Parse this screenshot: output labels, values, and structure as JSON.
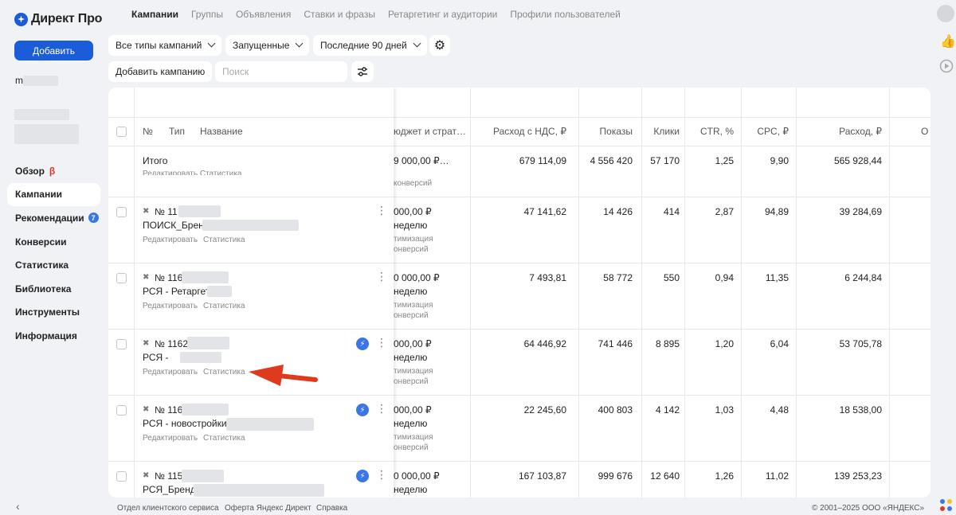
{
  "sidebar": {
    "logo_text": "Директ Про",
    "add_button": "Добавить",
    "account_letter": "m",
    "nav": [
      {
        "label": "Обзор",
        "badge": "β"
      },
      {
        "label": "Кампании",
        "active": true
      },
      {
        "label": "Рекомендации",
        "count": "7"
      },
      {
        "label": "Конверсии"
      },
      {
        "label": "Статистика"
      },
      {
        "label": "Библиотека"
      },
      {
        "label": "Инструменты"
      },
      {
        "label": "Информация"
      }
    ]
  },
  "tabs": [
    "Кампании",
    "Группы",
    "Объявления",
    "Ставки и фразы",
    "Ретаргетинг и аудитории",
    "Профили пользователей"
  ],
  "filters": {
    "type": "Все типы кампаний",
    "status": "Запущенные",
    "period": "Последние 90 дней",
    "add_campaign": "Добавить кампанию",
    "search_placeholder": "Поиск"
  },
  "table": {
    "headers": {
      "num": "№",
      "type": "Тип",
      "name": "Название",
      "budget": "юджет и страт…",
      "cost_vat": "Расход с НДС, ₽",
      "impressions": "Показы",
      "clicks": "Клики",
      "ctr": "CTR, %",
      "cpc": "CPC, ₽",
      "cost": "Расход, ₽",
      "extra": "О"
    },
    "total": {
      "label": "Итого",
      "budget": "9 000,00 ₽…",
      "cost_vat": "679 114,09",
      "impressions": "4 556 420",
      "clicks": "57 170",
      "ctr": "1,25",
      "cpc": "9,90",
      "cost": "565 928,44",
      "under_links": "Редактировать  Статистика",
      "under_budget": "конверсий"
    },
    "rows": [
      {
        "num": "№ 11",
        "name": "ПОИСК_Брен",
        "budget": "000,00 ₽",
        "budget2": "неделю",
        "strategy1": "тимизация",
        "strategy2": "онверсий",
        "cost_vat": "47 141,62",
        "impressions": "14 426",
        "clicks": "414",
        "ctr": "2,87",
        "cpc": "94,89",
        "cost": "39 284,69",
        "bolt": false
      },
      {
        "num": "№ 116",
        "name": "РСЯ - Ретаргет",
        "budget": "0 000,00 ₽",
        "budget2": "неделю",
        "strategy1": "тимизация",
        "strategy2": "онверсий",
        "cost_vat": "7 493,81",
        "impressions": "58 772",
        "clicks": "550",
        "ctr": "0,94",
        "cpc": "11,35",
        "cost": "6 244,84",
        "bolt": false
      },
      {
        "num": "№ 1162",
        "name": "РСЯ -",
        "budget": "000,00 ₽",
        "budget2": "неделю",
        "strategy1": "тимизация",
        "strategy2": "онверсий",
        "cost_vat": "64 446,92",
        "impressions": "741 446",
        "clicks": "8 895",
        "ctr": "1,20",
        "cpc": "6,04",
        "cost": "53 705,78",
        "bolt": true
      },
      {
        "num": "№ 116",
        "name": "РСЯ - новостройки",
        "budget": "000,00 ₽",
        "budget2": "неделю",
        "strategy1": "тимизация",
        "strategy2": "онверсий",
        "cost_vat": "22 245,60",
        "impressions": "400 803",
        "clicks": "4 142",
        "ctr": "1,03",
        "cpc": "4,48",
        "cost": "18 538,00",
        "bolt": true
      },
      {
        "num": "№ 115",
        "name": "РСЯ_Бренд_",
        "budget": "0 000,00 ₽",
        "budget2": "неделю",
        "strategy1": "",
        "strategy2": "",
        "cost_vat": "167 103,87",
        "impressions": "999 676",
        "clicks": "12 640",
        "ctr": "1,26",
        "cpc": "11,02",
        "cost": "139 253,23",
        "bolt": true
      }
    ],
    "link_edit": "Редактировать",
    "link_stats": "Статистика"
  },
  "footer": {
    "service": "Отдел клиентского сервиса",
    "offer": "Оферта Яндекс Директ",
    "help": "Справка",
    "copyright": "© 2001–2025 ООО «ЯНДЕКС»"
  },
  "icons": [
    "logo-star-icon",
    "chevron-down-icon",
    "gear-icon",
    "filter-settings-icon",
    "thumb-up-icon",
    "play-icon",
    "more-dots-icon",
    "lightning-icon",
    "autotarget-icon",
    "collapse-left-icon"
  ],
  "colors": {
    "accent": "#1b5cd8",
    "badge": "#3a76e8",
    "beta": "#e23a2a",
    "arrow": "#e03a1e"
  }
}
